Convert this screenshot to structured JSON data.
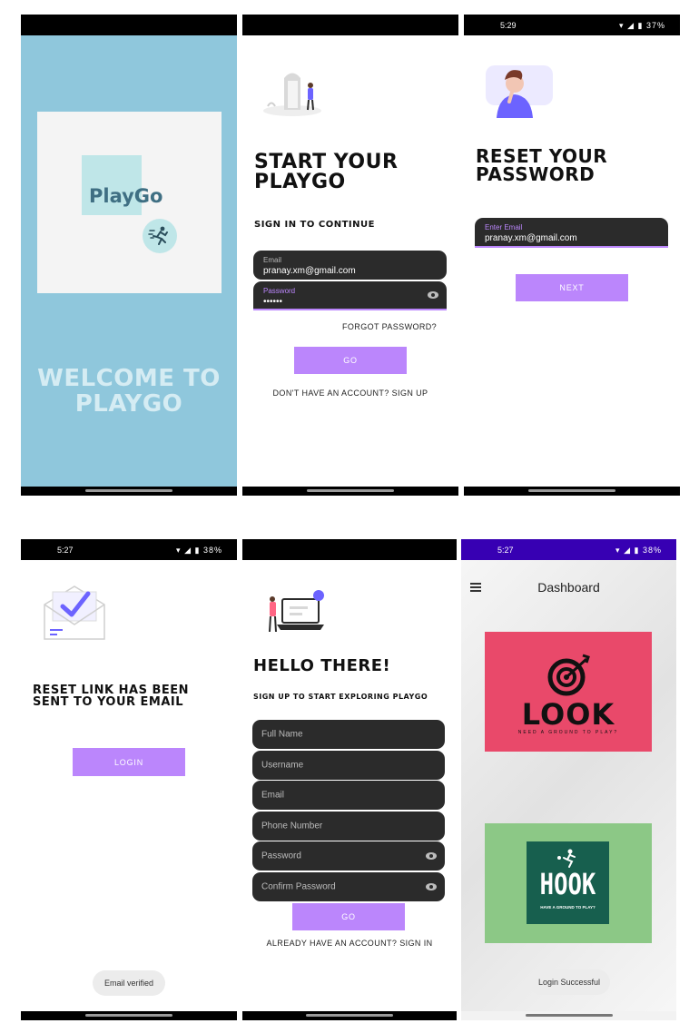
{
  "colors": {
    "splash_bg": "#8fc7dc",
    "accent_purple": "#bb86fc",
    "field_dark": "#2b2b2b",
    "dashboard_status": "#3700b3",
    "look_card": "#e9496a",
    "hook_card": "#8cc886",
    "hook_inner": "#175f4e"
  },
  "splash": {
    "logo_text": "PlayGo",
    "welcome_line1": "WELCOME TO",
    "welcome_line2": "PLAYGO"
  },
  "signin": {
    "title_line1": "START YOUR",
    "title_line2": "PLAYGO",
    "subtitle": "SIGN IN TO CONTINUE",
    "email_label": "Email",
    "email_value": "pranay.xm@gmail.com",
    "password_label": "Password",
    "password_value": "••••••",
    "forgot": "FORGOT PASSWORD?",
    "go_button": "GO",
    "signup_link": "DON'T HAVE AN ACCOUNT? SIGN UP"
  },
  "reset": {
    "status_time": "5:29",
    "status_battery": "37%",
    "title_line1": "RESET YOUR",
    "title_line2": "PASSWORD",
    "email_label": "Enter Email",
    "email_value": "pranay.xm@gmail.com",
    "next_button": "NEXT"
  },
  "sent": {
    "status_time": "5:27",
    "status_battery": "38%",
    "title_line1": "RESET LINK HAS BEEN",
    "title_line2": "SENT TO YOUR EMAIL",
    "login_button": "LOGIN",
    "toast": "Email verified"
  },
  "signup": {
    "title": "HELLO THERE!",
    "subtitle": "SIGN UP TO START EXPLORING PLAYGO",
    "fields": [
      "Full Name",
      "Username",
      "Email",
      "Phone Number",
      "Password",
      "Confirm Password"
    ],
    "go_button": "GO",
    "signin_link": "ALREADY HAVE AN ACCOUNT? SIGN IN"
  },
  "dashboard": {
    "status_time": "5:27",
    "status_battery": "38%",
    "title": "Dashboard",
    "look_name": "LOOK",
    "look_tagline": "NEED A GROUND TO PLAY?",
    "hook_name": "HOOK",
    "hook_tagline": "HAVE A GROUND TO PLAY?",
    "toast": "Login Successful"
  }
}
